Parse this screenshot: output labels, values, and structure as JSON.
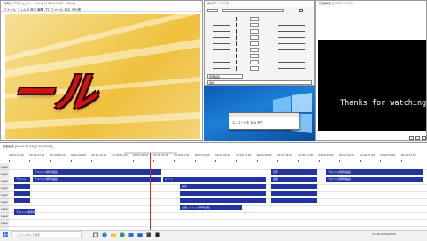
{
  "main_window": {
    "title": "無題のプロジェクト - AviUtl  [1920x1080, 30fps]",
    "menu": "ファイル フィルタ 設定 編集 プロファイル 表示 その他",
    "preview_text": "ール"
  },
  "settings_window": {
    "title": "設定ダイアログ",
    "combo_value": "標準描画",
    "combo_value_2": "通常"
  },
  "dialog": {
    "text": "エンコード中 15% 完了"
  },
  "ext_window": {
    "title": "拡張編集 [00:00:44.93]",
    "screen_text": "Thanks for watching"
  },
  "timeline": {
    "title": "拡張編集 [00:00:44.93] [1354/2247]",
    "time_labels": [
      "00:00:00.00",
      "00:00:03.00",
      "00:00:06.00",
      "00:00:09.00",
      "00:00:12.00",
      "00:00:15.00",
      "00:00:18.00",
      "00:00:21.00",
      "00:00:24.00",
      "00:00:27.00",
      "00:00:30.00",
      "00:00:33.00",
      "00:00:36.00",
      "00:00:39.00",
      "00:00:42.00",
      "00:00:45.00",
      "00:00:48.00",
      "00:00:51.00",
      "00:00:54.00",
      "00:00:57.00"
    ],
    "layers": [
      "Layer 1",
      "Layer 2",
      "Layer 3",
      "Layer 4",
      "Layer 5",
      "Layer 6",
      "Layer 7",
      "Layer 8",
      "Layer 9",
      "Layer 10"
    ],
    "clips": [
      {
        "label": "テキスト[標準描画]"
      },
      {
        "label": "テキスト[標準描画]"
      },
      {
        "label": "動画ファイル[標準描画]"
      },
      {
        "label": "テキスト[標準描画]"
      },
      {
        "label": "音声"
      },
      {
        "label": "シーン"
      },
      {
        "label": "画像"
      },
      {
        "label": "テキスト[標準描画]"
      },
      {
        "label": "図形"
      },
      {
        "label": "テキスト[標準描画]"
      },
      {
        "label": "テキスト"
      }
    ]
  },
  "taskbar": {
    "search_placeholder": "ここに入力して検索",
    "clock": "11:48 2021/06/06"
  }
}
